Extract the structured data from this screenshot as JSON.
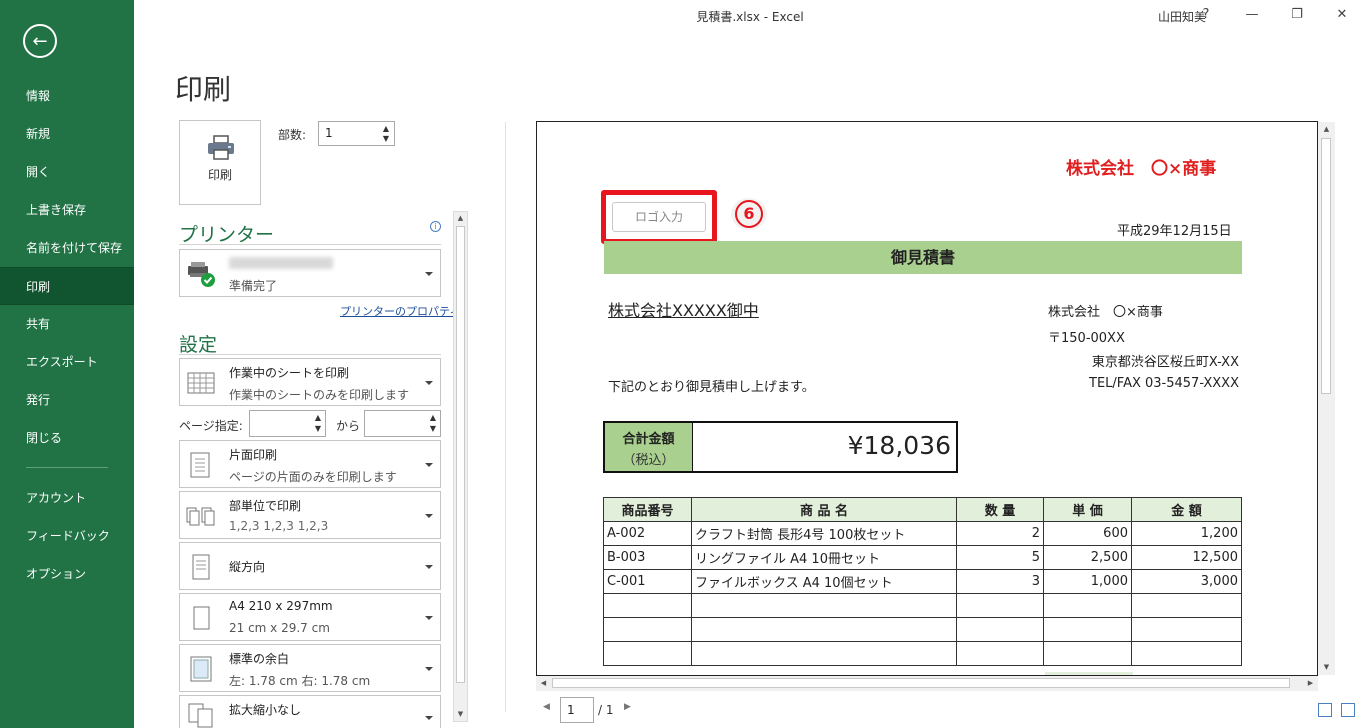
{
  "window": {
    "title": "見積書.xlsx  -  Excel",
    "user": "山田知美",
    "help": "?",
    "minimize": "—",
    "restore": "❐",
    "close": "✕"
  },
  "sidebar": {
    "back_icon": "←",
    "items": [
      {
        "label": "情報"
      },
      {
        "label": "新規"
      },
      {
        "label": "開く"
      },
      {
        "label": "上書き保存"
      },
      {
        "label": "名前を付けて保存"
      },
      {
        "label": "印刷"
      },
      {
        "label": "共有"
      },
      {
        "label": "エクスポート"
      },
      {
        "label": "発行"
      },
      {
        "label": "閉じる"
      },
      {
        "label": "アカウント"
      },
      {
        "label": "フィードバック"
      },
      {
        "label": "オプション"
      }
    ],
    "active_color": "#10552f",
    "bg_color": "#217346"
  },
  "print_panel": {
    "heading": "印刷",
    "print_button_label": "印刷",
    "copies_label": "部数:",
    "copies_value": "1",
    "printer_section": "プリンター",
    "printer_status": "準備完了",
    "printer_properties_link": "プリンターのプロパティ",
    "settings_section": "設定",
    "settings": [
      {
        "main": "作業中のシートを印刷",
        "sub": "作業中のシートのみを印刷します"
      },
      {
        "main": "片面印刷",
        "sub": "ページの片面のみを印刷します"
      },
      {
        "main": "部単位で印刷",
        "sub": "1,2,3    1,2,3    1,2,3"
      },
      {
        "main": "縦方向",
        "sub": ""
      },
      {
        "main": "A4 210 x 297mm",
        "sub": "21 cm x 29.7 cm"
      },
      {
        "main": "標準の余白",
        "sub": "左: 1.78 cm    右: 1.78 cm"
      },
      {
        "main": "拡大縮小なし",
        "sub": ""
      }
    ],
    "page_range_label": "ページ指定:",
    "page_to_label": "から"
  },
  "preview": {
    "company_red": "株式会社　〇×商事",
    "logo_placeholder": "ロゴ入力",
    "step_badge": "6",
    "date": "平成29年12月15日",
    "banner_title": "御見積書",
    "recipient": "株式会社XXXXX御中",
    "sender_lines": [
      "株式会社　〇×商事",
      "〒150-00XX",
      "東京都渋谷区桜丘町X-XX",
      "TEL/FAX 03-5457-XXXX"
    ],
    "note": "下記のとおり御見積申し上げます。",
    "total_label": "合計金額",
    "total_tax": "（税込）",
    "total_value": "¥18,036",
    "table_headers": [
      "商品番号",
      "商 品 名",
      "数 量",
      "単 価",
      "金 額"
    ],
    "rows": [
      [
        "A-002",
        "クラフト封筒 長形4号 100枚セット",
        "2",
        "600",
        "1,200"
      ],
      [
        "B-003",
        "リングファイル A4 10冊セット",
        "5",
        "2,500",
        "12,500"
      ],
      [
        "C-001",
        "ファイルボックス A4 10個セット",
        "3",
        "1,000",
        "3,000"
      ],
      [
        "",
        "",
        "",
        "",
        ""
      ],
      [
        "",
        "",
        "",
        "",
        ""
      ],
      [
        "",
        "",
        "",
        "",
        ""
      ]
    ],
    "page_current": "1",
    "page_total": "/ 1",
    "highlight_color": "#e8141e",
    "banner_color": "#a9d08e"
  }
}
